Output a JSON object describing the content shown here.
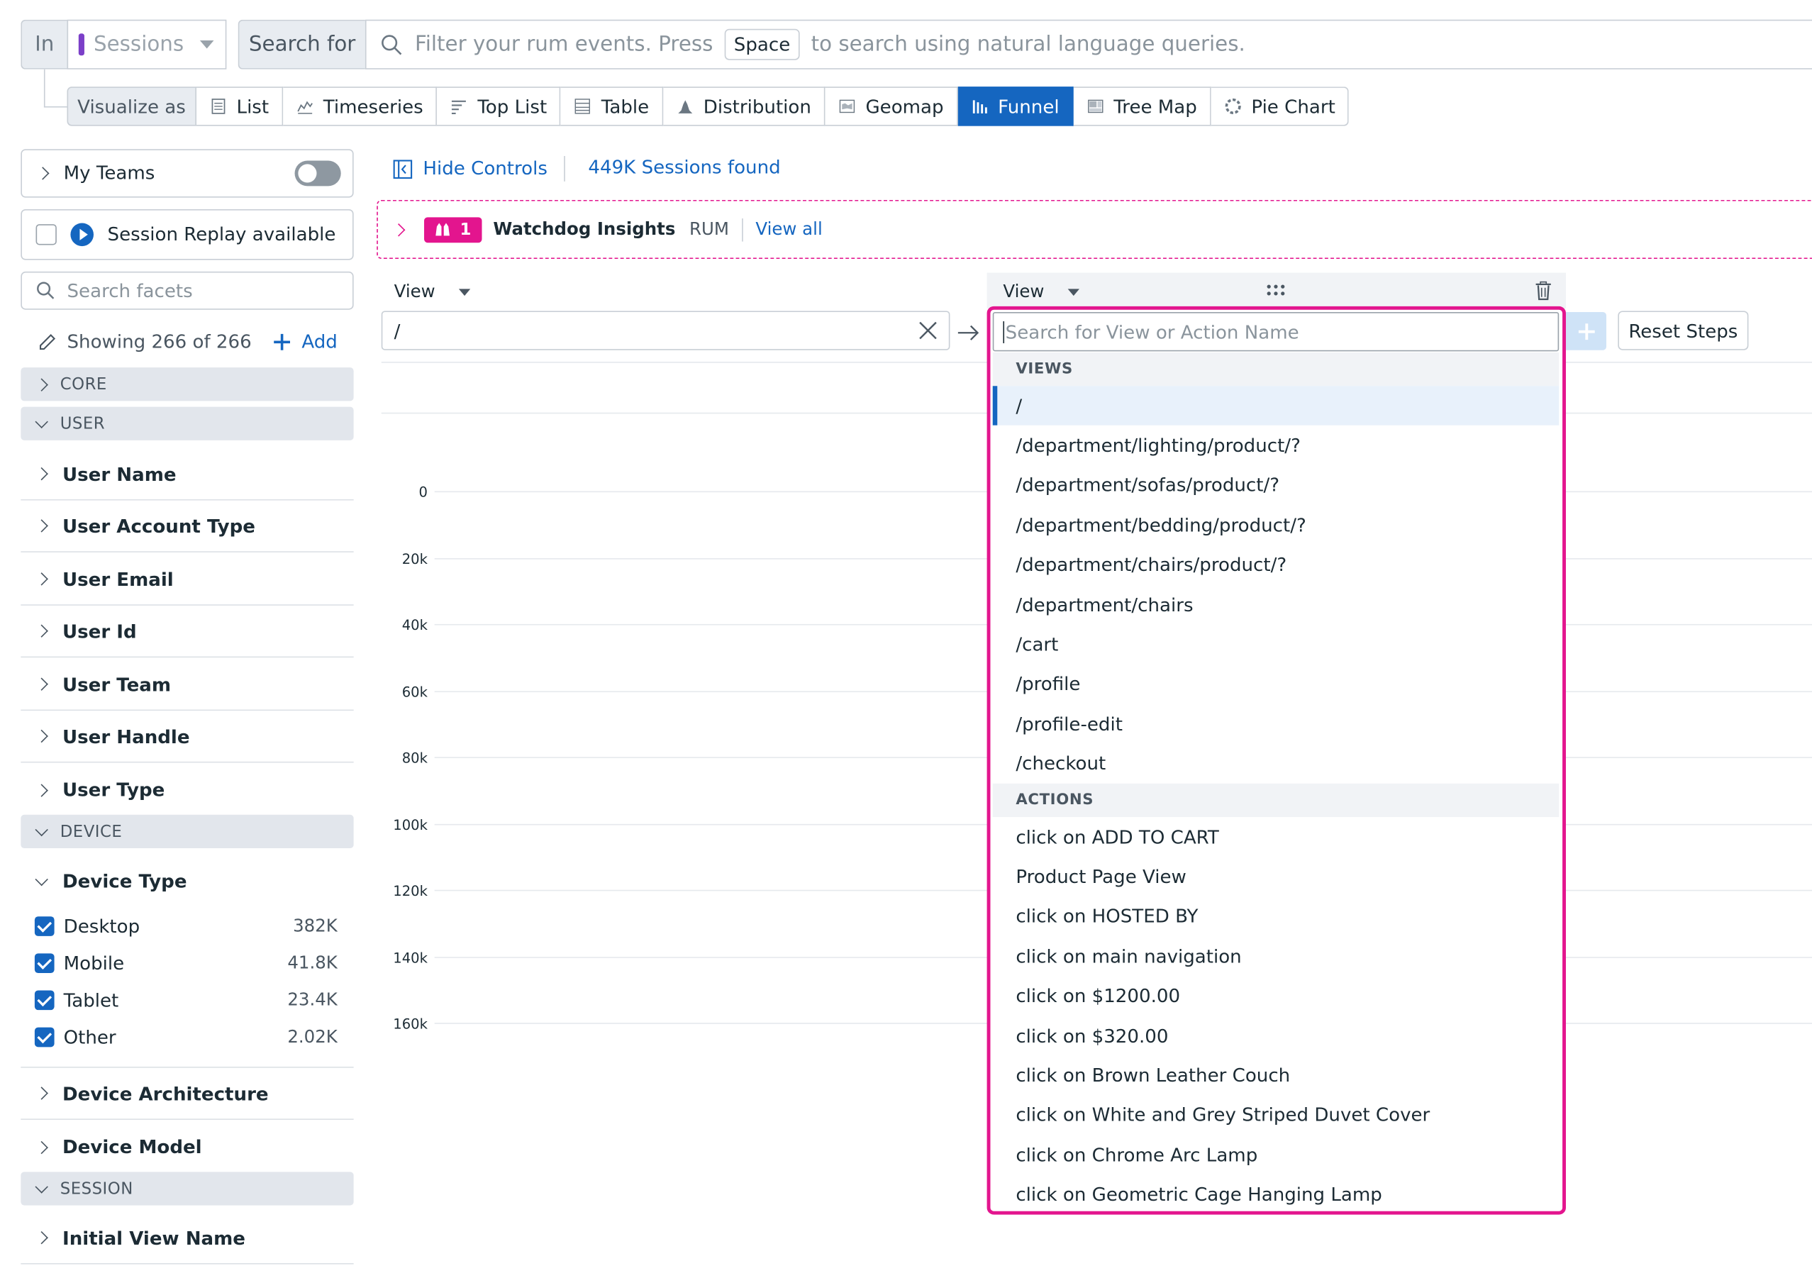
{
  "search_bar": {
    "in_label": "In",
    "source": "Sessions",
    "search_for_label": "Search for",
    "placeholder_before": "Filter your rum events. Press",
    "space_key": "Space",
    "placeholder_after": "to search using natural language queries."
  },
  "visualize": {
    "label": "Visualize as",
    "options": [
      {
        "label": "List",
        "icon": "list-icon"
      },
      {
        "label": "Timeseries",
        "icon": "timeseries-icon"
      },
      {
        "label": "Top List",
        "icon": "toplist-icon"
      },
      {
        "label": "Table",
        "icon": "table-icon"
      },
      {
        "label": "Distribution",
        "icon": "distribution-icon"
      },
      {
        "label": "Geomap",
        "icon": "geomap-icon"
      },
      {
        "label": "Funnel",
        "icon": "funnel-icon"
      },
      {
        "label": "Tree Map",
        "icon": "treemap-icon"
      },
      {
        "label": "Pie Chart",
        "icon": "piechart-icon"
      }
    ],
    "active": "Funnel"
  },
  "sidebar": {
    "my_teams": "My Teams",
    "session_replay": "Session Replay available",
    "search_placeholder": "Search facets",
    "showing": "Showing 266 of 266",
    "add": "Add",
    "sections": {
      "core": "CORE",
      "user": "USER",
      "device": "DEVICE",
      "session": "SESSION"
    },
    "user_facets": [
      "User Name",
      "User Account Type",
      "User Email",
      "User Id",
      "User Team",
      "User Handle",
      "User Type"
    ],
    "device_type": {
      "label": "Device Type",
      "values": [
        {
          "name": "Desktop",
          "count": "382K"
        },
        {
          "name": "Mobile",
          "count": "41.8K"
        },
        {
          "name": "Tablet",
          "count": "23.4K"
        },
        {
          "name": "Other",
          "count": "2.02K"
        }
      ]
    },
    "device_facets": [
      "Device Architecture",
      "Device Model"
    ],
    "session_facets": [
      "Initial View Name"
    ]
  },
  "main": {
    "hide_controls": "Hide Controls",
    "sessions_found": "449K Sessions found",
    "watchdog": {
      "count": "1",
      "title": "Watchdog Insights",
      "tag": "RUM",
      "view_all": "View all"
    },
    "step1": {
      "type": "View",
      "value": "/"
    },
    "step2": {
      "type": "View",
      "placeholder": "Search for View or Action Name"
    },
    "reset_steps": "Reset Steps",
    "y_axis_ticks": [
      "0",
      "20k",
      "40k",
      "60k",
      "80k",
      "100k",
      "120k",
      "140k",
      "160k"
    ]
  },
  "dropdown": {
    "views_header": "VIEWS",
    "views": [
      "/",
      "/department/lighting/product/?",
      "/department/sofas/product/?",
      "/department/bedding/product/?",
      "/department/chairs/product/?",
      "/department/chairs",
      "/cart",
      "/profile",
      "/profile-edit",
      "/checkout"
    ],
    "actions_header": "ACTIONS",
    "actions": [
      "click on ADD TO CART",
      "Product Page View",
      "click on HOSTED BY",
      "click on main navigation",
      "click on $1200.00",
      "click on $320.00",
      "click on Brown Leather Couch",
      "click on White and Grey Striped Duvet Cover",
      "click on Chrome Arc Lamp",
      "click on Geometric Cage Hanging Lamp"
    ]
  },
  "colors": {
    "accent": "#1566c0",
    "watchdog_pink": "#e3158e",
    "sessions_purple": "#7b3fc8"
  }
}
